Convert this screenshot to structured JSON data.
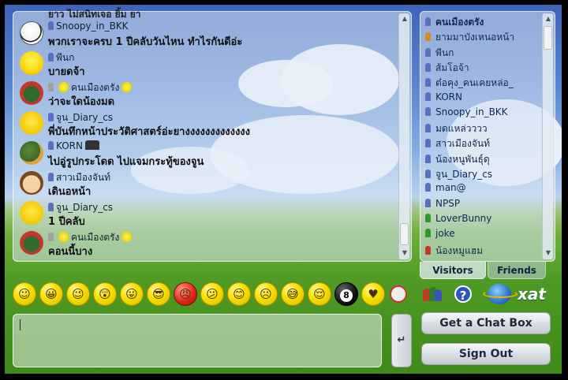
{
  "messages": [
    {
      "name": "Snoopy_in_BKK",
      "text": "พวกเราจะครบ 1 ปีคลับวันไหน ทำไรกันดีอ่ะ",
      "avatar": "snoopy-avatar"
    },
    {
      "name": "พีนก",
      "text": "บายดจ้า",
      "avatar": "tweety-avatar"
    },
    {
      "name": "คนเมืองตรัง",
      "text": "ว่าจะใดน้องมด",
      "avatar": "jester-avatar"
    },
    {
      "name": "จูน_Diary_cs",
      "text": "พี่บันทึกหน้าประวัติศาสตร์อ่ะยางงงงงงงงงงงงง",
      "avatar": "pikachu-avatar"
    },
    {
      "name": "KORN",
      "text": "ไปอู่รูปกระโดด ไปแจมกระทู้ของจูน",
      "avatar": "duck-avatar"
    },
    {
      "name": "สาวเมืองจันท์",
      "text": "เดินอหน้า",
      "avatar": "girl-avatar"
    },
    {
      "name": "จูน_Diary_cs",
      "text": "1 ปีคลับ",
      "avatar": "pikachu-avatar"
    },
    {
      "name": "คนเมืองตรัง",
      "text": "คอนนี้บาง",
      "avatar": "jester-avatar"
    }
  ],
  "top_partial_text": "ยาว ไม่สนิทเจอ ยิ้ม ยา",
  "users": [
    {
      "name": "คนเมืองตรัง",
      "color": "#5c6fbf",
      "bold": true
    },
    {
      "name": "ยามมาบังเหนอหน้า",
      "color": "#d98a1a",
      "bold": false
    },
    {
      "name": "พีนก",
      "color": "#5c6fbf",
      "bold": false
    },
    {
      "name": "ส้มโอจ้า",
      "color": "#5c6fbf",
      "bold": false
    },
    {
      "name": "ต๋อคุง_คนเคยหล่อ_",
      "color": "#5c6fbf",
      "bold": false
    },
    {
      "name": "KORN",
      "color": "#5c6fbf",
      "bold": false
    },
    {
      "name": "Snoopy_in_BKK",
      "color": "#5c6fbf",
      "bold": false
    },
    {
      "name": "มดแหล่วววว",
      "color": "#5c6fbf",
      "bold": false
    },
    {
      "name": "สาวเมืองจันท์",
      "color": "#5c6fbf",
      "bold": false
    },
    {
      "name": "น้องหนูพันธุ์ดุ",
      "color": "#5c6fbf",
      "bold": false
    },
    {
      "name": "จูน_Diary_cs",
      "color": "#5c6fbf",
      "bold": false
    },
    {
      "name": "man@",
      "color": "#5c6fbf",
      "bold": false
    },
    {
      "name": "NPSP",
      "color": "#5c6fbf",
      "bold": false
    },
    {
      "name": "LoverBunny",
      "color": "#2e9a2e",
      "bold": false
    },
    {
      "name": "joke",
      "color": "#2e9a2e",
      "bold": false
    },
    {
      "name": "น้องหมูแฮม",
      "color": "#c0392b",
      "bold": false
    }
  ],
  "tabs": {
    "visitors": "Visitors",
    "friends": "Friends"
  },
  "buttons": {
    "get_chat_box": "Get a Chat Box",
    "sign_out": "Sign Out",
    "send": "↵"
  },
  "logo": {
    "text": "xat"
  },
  "input": {
    "value": ""
  },
  "smileys": [
    "smile",
    "grin",
    "wink",
    "surprised",
    "tongue",
    "cool",
    "angry",
    "confused",
    "blush",
    "sad",
    "sweat",
    "pleased",
    "eight-ball",
    "hearts"
  ]
}
